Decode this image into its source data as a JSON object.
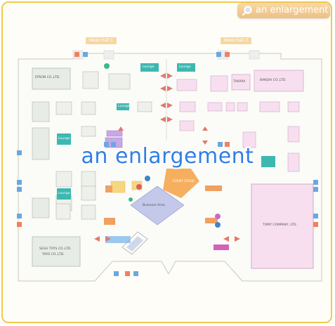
{
  "header": {
    "enlarge_button_label": "an enlargement"
  },
  "halls": {
    "west_hall_1": "West Hall 1",
    "west_hall_2": "West Hall 2"
  },
  "booths": {
    "epson": "EPSON CO.,LTD.",
    "tomy": "TOMY COMPANY, LTD.",
    "sega": "SEGA TOYS CO.,LTD.",
    "sega2": "TAYO CO.,LTD.",
    "takara": "TAKARA",
    "bandai": "BANDAI CO.,LTD.",
    "event_stage": "EVENT STAGE",
    "business_area": "Business Area",
    "lounge": "Lounge"
  },
  "overlay": {
    "text": "an enlargement"
  }
}
